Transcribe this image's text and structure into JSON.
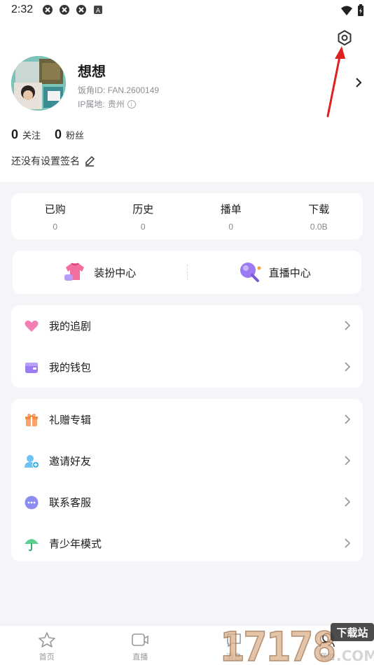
{
  "status_bar": {
    "time": "2:32"
  },
  "profile": {
    "name": "想想",
    "fan_id_label": "饭角ID:",
    "fan_id": "FAN.2600149",
    "ip_label": "IP属地:",
    "ip_location": "贵州",
    "following_count": "0",
    "following_label": "关注",
    "fans_count": "0",
    "fans_label": "粉丝",
    "signature": "还没有设置签名"
  },
  "stats": [
    {
      "label": "已购",
      "value": "0"
    },
    {
      "label": "历史",
      "value": "0"
    },
    {
      "label": "播单",
      "value": "0"
    },
    {
      "label": "下载",
      "value": "0.0B"
    }
  ],
  "centers": [
    {
      "label": "装扮中心",
      "icon": "shirt-icon"
    },
    {
      "label": "直播中心",
      "icon": "microphone-icon"
    }
  ],
  "menu_group_1": [
    {
      "label": "我的追剧",
      "icon": "heart-icon"
    },
    {
      "label": "我的钱包",
      "icon": "wallet-icon"
    }
  ],
  "menu_group_2": [
    {
      "label": "礼赠专辑",
      "icon": "gift-icon"
    },
    {
      "label": "邀请好友",
      "icon": "invite-user-icon"
    },
    {
      "label": "联系客服",
      "icon": "chat-icon"
    },
    {
      "label": "青少年模式",
      "icon": "umbrella-icon"
    }
  ],
  "bottom_nav": [
    {
      "label": "首页",
      "icon": "home-icon"
    },
    {
      "label": "直播",
      "icon": "live-icon"
    },
    {
      "label": "消息",
      "icon": "message-icon"
    },
    {
      "label": "我的",
      "icon": "profile-icon"
    }
  ],
  "watermark": {
    "text": "17178",
    "sub": "下载站",
    "domain": ".COM"
  },
  "colors": {
    "accent_red": "#e02020",
    "background": "#f4f5f9",
    "card": "#ffffff"
  }
}
